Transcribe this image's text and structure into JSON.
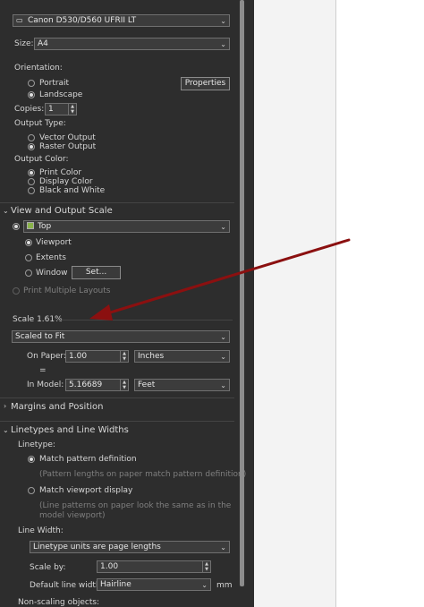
{
  "printer": {
    "name": "Canon D530/D560 UFRII LT"
  },
  "size": {
    "label": "Size:",
    "value": "A4"
  },
  "orientation": {
    "label": "Orientation:",
    "portrait": "Portrait",
    "landscape": "Landscape",
    "properties_button": "Properties"
  },
  "copies": {
    "label": "Copies:",
    "value": "1"
  },
  "output_type": {
    "label": "Output Type:",
    "vector": "Vector Output",
    "raster": "Raster Output"
  },
  "output_color": {
    "label": "Output Color:",
    "print": "Print Color",
    "display": "Display Color",
    "bw": "Black and White"
  },
  "view_scale": {
    "title": "View and Output Scale",
    "view_value": "Top",
    "viewport": "Viewport",
    "extents": "Extents",
    "window": "Window",
    "set_button": "Set...",
    "print_multiple": "Print Multiple Layouts"
  },
  "scale": {
    "label": "Scale 1.61%",
    "mode": "Scaled to Fit",
    "on_paper_label": "On Paper:",
    "on_paper_value": "1.00",
    "on_paper_unit": "Inches",
    "equals": "=",
    "in_model_label": "In Model:",
    "in_model_value": "5.16689",
    "in_model_unit": "Feet"
  },
  "margins": {
    "title": "Margins and Position"
  },
  "linetypes": {
    "title": "Linetypes and Line Widths",
    "linetype_label": "Linetype:",
    "match_pattern": "Match pattern definition",
    "match_pattern_desc": "(Pattern lengths on paper match pattern definition)",
    "match_viewport": "Match viewport display",
    "match_viewport_desc1": "(Line patterns on paper look the same as in the",
    "match_viewport_desc2": "model viewport)",
    "line_width_label": "Line Width:",
    "line_width_mode": "Linetype units are page lengths",
    "scale_by_label": "Scale by:",
    "scale_by_value": "1.00",
    "default_width_label": "Default line width:",
    "default_width_value": "Hairline",
    "default_width_unit": "mm",
    "non_scaling": "Non-scaling objects:"
  },
  "colors": {
    "panel_bg": "#2d2d2d",
    "arrow": "#8b1010"
  }
}
